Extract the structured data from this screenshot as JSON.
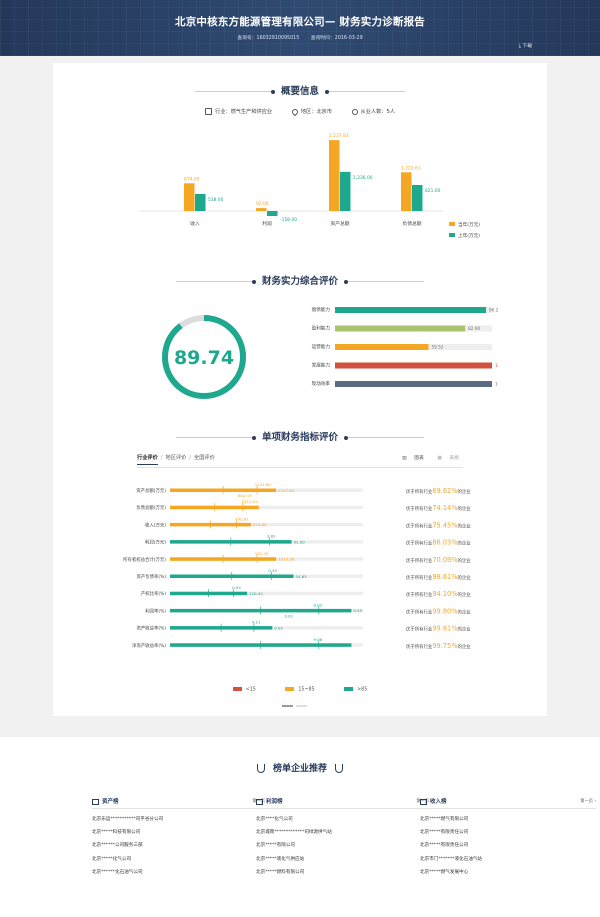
{
  "header": {
    "title": "北京中核东方能源管理有限公司— 财务实力诊断报告",
    "query_no": "查询号：16032910095015",
    "query_time": "查询时间：2016-03-29",
    "download": "下载"
  },
  "overview": {
    "title": "概要信息",
    "industry": "行业：燃气生产和供应业",
    "region": "地区：北京市",
    "employees": "从业人数：5人"
  },
  "colors": {
    "this_year": "#f5a623",
    "last_year": "#1ea88e",
    "red": "#d0523e",
    "navy": "#2b3d5c",
    "green_light": "#a9c46f",
    "slate": "#5b6b80"
  },
  "chart_data": [
    {
      "type": "bar",
      "categories": [
        "收入",
        "利润",
        "资产总额",
        "负债总额"
      ],
      "series": [
        {
          "name": "当年(万元)",
          "values": [
            874.0,
            92.0,
            2237.83,
            1222.61
          ]
        },
        {
          "name": "上年(万元)",
          "values": [
            538.0,
            -158.0,
            1236.0,
            821.0
          ]
        }
      ],
      "data_labels": [
        [
          "874.00",
          "92.00",
          "2,237.83",
          "1,222.61"
        ],
        [
          "538.00",
          "-158.00",
          "1,236.00",
          "821.00"
        ]
      ],
      "ylim": [
        -200,
        2400
      ]
    },
    {
      "type": "bar",
      "orientation": "horizontal",
      "categories": [
        "偿债能力",
        "盈利能力",
        "运营能力",
        "发展能力",
        "现动效率"
      ],
      "values": [
        96.2,
        82.9,
        59.52,
        100.0,
        100.0
      ],
      "xlim": [
        0,
        100
      ]
    }
  ],
  "score": {
    "title": "财务实力综合评价",
    "value": "89.74",
    "percent": 89.74
  },
  "indicators": {
    "title": "单项财务指标评价",
    "tabs": [
      "行业评价",
      "地区评价",
      "全国评价"
    ],
    "views": [
      "图表",
      "表格"
    ],
    "items": [
      {
        "name": "资产总额(万元)",
        "pct": 0.55,
        "color": "orange",
        "labels": [
          "1121.80",
          "2237.83",
          "644.43"
        ],
        "prefix": "优于所有行业",
        "rank": "69.62%",
        "suffix": "的企业"
      },
      {
        "name": "负债总额(万元)",
        "pct": 0.46,
        "color": "orange",
        "labels": [
          "1222.61"
        ],
        "prefix": "优于所有行业",
        "rank": "74.14%",
        "suffix": "的企业"
      },
      {
        "name": "收入(万元)",
        "pct": 0.42,
        "color": "orange",
        "labels": [
          "490.61",
          "874.00"
        ],
        "prefix": "优于所有行业",
        "rank": "75.45%",
        "suffix": "的企业"
      },
      {
        "name": "利润(万元)",
        "pct": 0.63,
        "color": "teal",
        "labels": [
          "3.82",
          "92.00"
        ],
        "prefix": "优于所有行业",
        "rank": "86.03%",
        "suffix": "的企业"
      },
      {
        "name": "所有者权益合计(万元)",
        "pct": 0.55,
        "color": "orange",
        "labels": [
          "141.35",
          "1015.26"
        ],
        "prefix": "优于所有行业",
        "rank": "70.09%",
        "suffix": "的企业"
      },
      {
        "name": "资产负债率(%)",
        "pct": 0.64,
        "color": "teal",
        "labels": [
          "0.35",
          "54.63"
        ],
        "prefix": "优于所有行业",
        "rank": "98.61%",
        "suffix": "的企业"
      },
      {
        "name": "产权比率(%)",
        "pct": 0.4,
        "color": "teal",
        "labels": [
          "0.94",
          "120.42"
        ],
        "prefix": "优于所有行业",
        "rank": "94.10%",
        "suffix": "的企业"
      },
      {
        "name": "利润率(%)",
        "pct": 0.94,
        "color": "teal",
        "labels": [
          "0.02",
          "9.45",
          "0.01"
        ],
        "prefix": "优于所有行业",
        "rank": "99.80%",
        "suffix": "的企业"
      },
      {
        "name": "资产收益率(%)",
        "pct": 0.53,
        "color": "teal",
        "labels": [
          "4.11",
          "0.02"
        ],
        "prefix": "优于所有行业",
        "rank": "99.81%",
        "suffix": "的企业"
      },
      {
        "name": "净资产收益率(%)",
        "pct": 0.94,
        "color": "teal",
        "labels": [
          "9.06"
        ],
        "prefix": "优于所有行业",
        "rank": "99.75%",
        "suffix": "的企业"
      }
    ],
    "legend": [
      "<15",
      "15~85",
      ">85"
    ]
  },
  "recommend": {
    "title": "榜单企业推荐",
    "page_label": "第一页",
    "columns": [
      {
        "name": "资产榜",
        "items": [
          "北京乐运***********司平谷分公司",
          "北京*****科技有限公司",
          "北京******公司服务三部",
          "北京*****化气公司",
          "北京******化石油气公司"
        ]
      },
      {
        "name": "利润榜",
        "items": [
          "北京****化气公司",
          "北京城南*************司绿源供气站",
          "北京*****有限公司",
          "北京*****液化气供应站",
          "北京*****燃料有限公司"
        ]
      },
      {
        "name": "收入榜",
        "items": [
          "北京*****燃气有限公司",
          "北京*****有限责任公司",
          "北京*****有限责任公司",
          "北京市门*******液化石油气站",
          "北京*****燃气发展中心"
        ]
      }
    ]
  }
}
